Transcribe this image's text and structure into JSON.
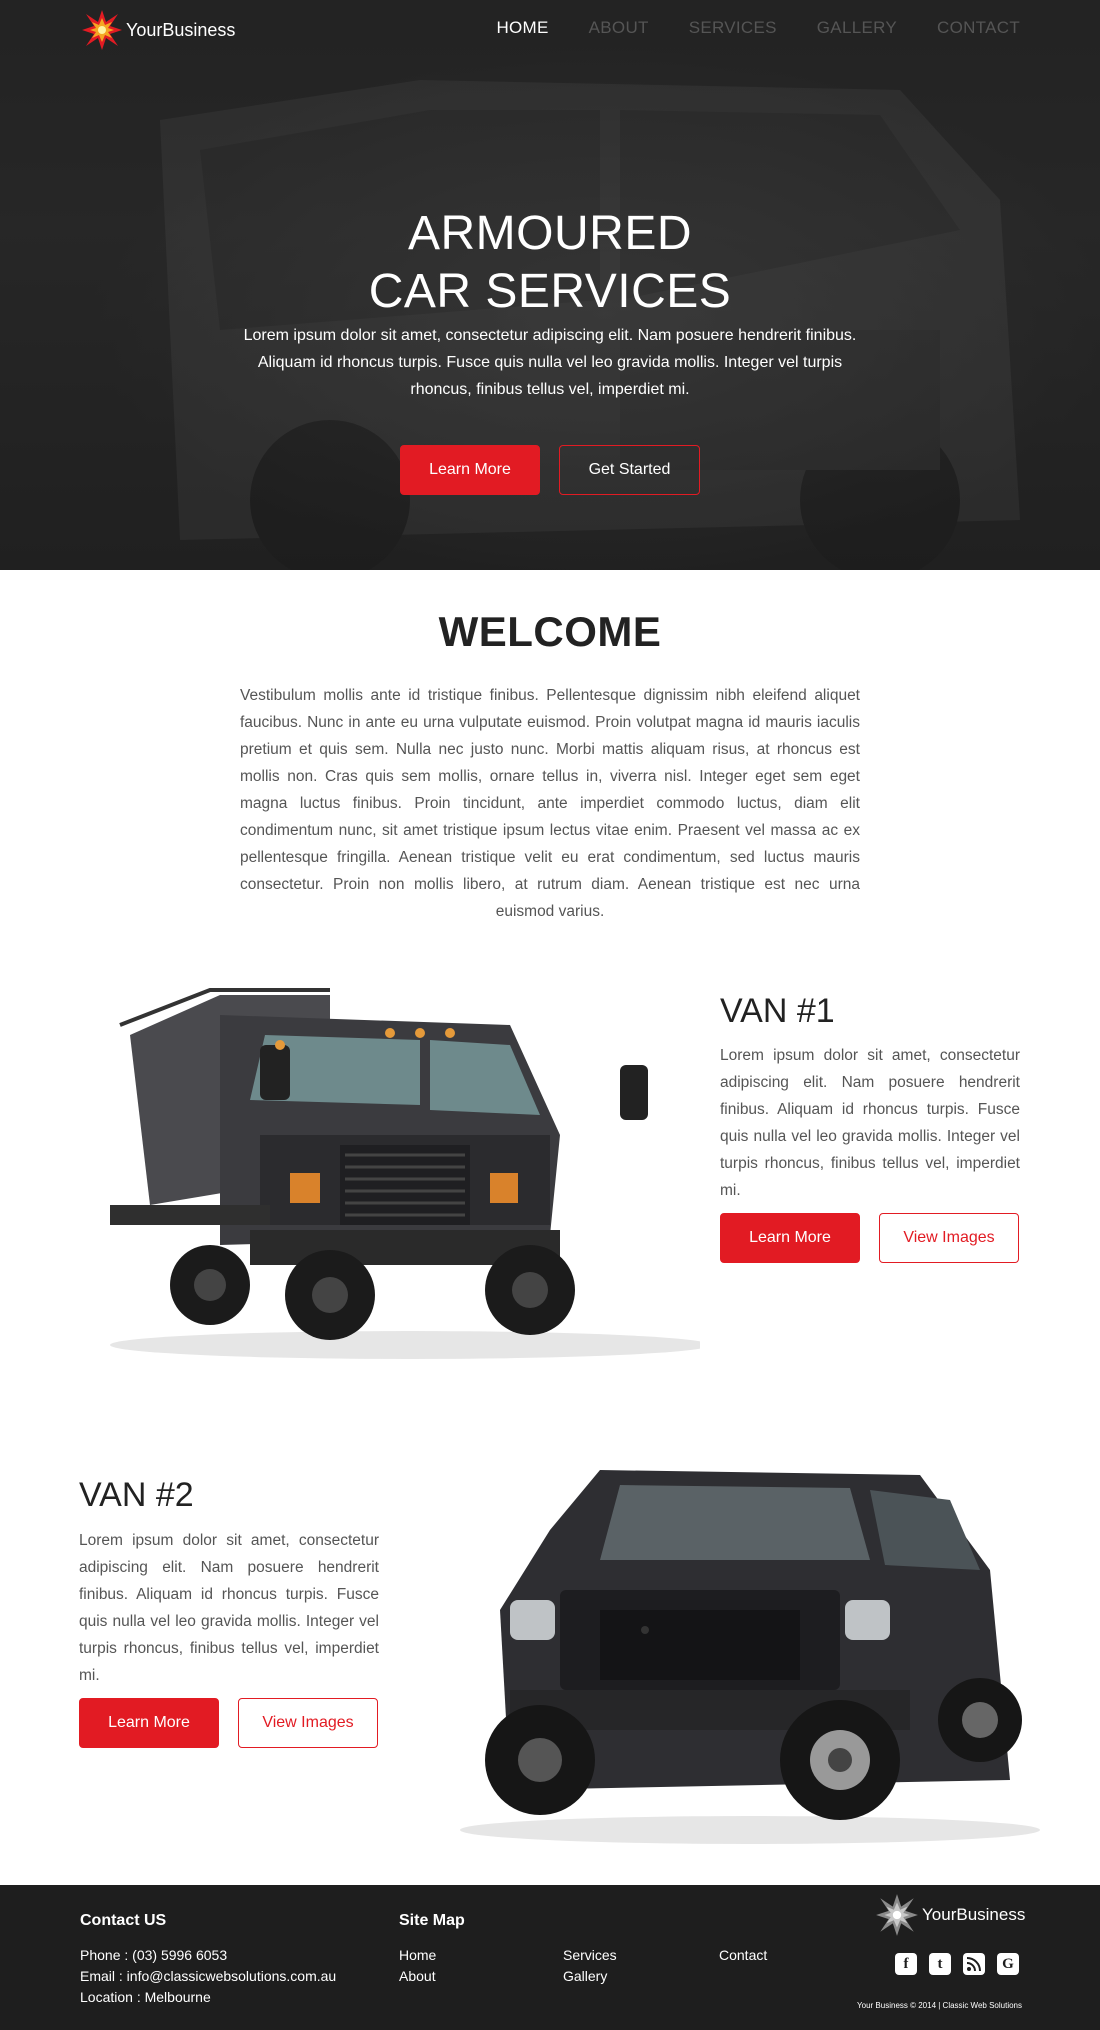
{
  "brand": {
    "name": "YourBusiness",
    "accent": "#e21b23"
  },
  "nav": {
    "items": [
      {
        "label": "HOME",
        "active": true
      },
      {
        "label": "ABOUT",
        "active": false
      },
      {
        "label": "SERVICES",
        "active": false
      },
      {
        "label": "GALLERY",
        "active": false
      },
      {
        "label": "CONTACT",
        "active": false
      }
    ]
  },
  "hero": {
    "title_line1": "ARMOURED",
    "title_line2": "CAR SERVICES",
    "subtitle": "Lorem ipsum dolor sit amet, consectetur adipiscing elit. Nam posuere hendrerit finibus. Aliquam id rhoncus turpis. Fusce quis nulla vel leo gravida mollis. Integer vel turpis rhoncus, finibus tellus vel, imperdiet mi.",
    "learn_more": "Learn More",
    "get_started": "Get Started"
  },
  "welcome": {
    "title": "WELCOME",
    "text": "Vestibulum mollis ante id tristique finibus. Pellentesque dignissim nibh eleifend aliquet faucibus. Nunc in ante eu urna vulputate euismod. Proin volutpat magna id mauris iaculis pretium et quis sem. Nulla nec justo nunc. Morbi mattis aliquam risus, at rhoncus est mollis non. Cras quis sem mollis, ornare tellus in, viverra nisl. Integer eget sem eget magna luctus finibus. Proin tincidunt, ante imperdiet commodo luctus, diam elit condimentum nunc, sit amet tristique ipsum lectus vitae enim. Praesent vel massa ac ex pellentesque fringilla. Aenean tristique velit eu erat condimentum, sed luctus mauris consectetur. Proin non mollis libero, at rutrum diam. Aenean tristique est nec urna euismod varius."
  },
  "van1": {
    "title": "VAN #1",
    "text": "Lorem ipsum dolor sit amet, consectetur adipiscing elit. Nam posuere hendrerit finibus. Aliquam id rhoncus turpis. Fusce quis nulla vel leo gravida mollis. Integer vel turpis rhoncus, finibus tellus vel, imperdiet mi.",
    "learn_more": "Learn More",
    "view_images": "View Images"
  },
  "van2": {
    "title": "VAN #2",
    "text": "Lorem ipsum dolor sit amet, consectetur adipiscing elit. Nam posuere hendrerit finibus. Aliquam id rhoncus turpis. Fusce quis nulla vel leo gravida mollis. Integer vel turpis rhoncus, finibus tellus vel, imperdiet mi.",
    "learn_more": "Learn More",
    "view_images": "View Images"
  },
  "footer": {
    "contact_title": "Contact US",
    "phone": "Phone : (03) 5996 6053",
    "email": "Email : info@classicwebsolutions.com.au",
    "location": "Location : Melbourne",
    "sitemap_title": "Site Map",
    "links": {
      "home": "Home",
      "about": "About",
      "services": "Services",
      "gallery": "Gallery",
      "contact": "Contact"
    },
    "brand": "YourBusiness",
    "social": {
      "facebook": "f",
      "twitter": "t",
      "rss": "rss",
      "google": "G"
    },
    "copyright": "Your Business © 2014  |  Classic Web Solutions"
  }
}
